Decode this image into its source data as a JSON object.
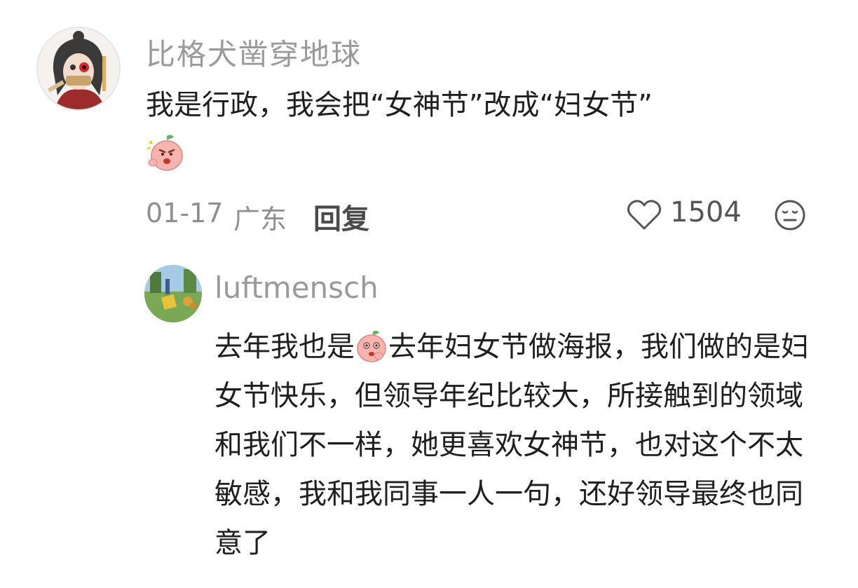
{
  "main_comment": {
    "username": "比格犬凿穿地球",
    "text": "我是行政，我会把“女神节”改成“妇女节”",
    "emoji_icon": "angry-peach-emoji",
    "date": "01-17",
    "location": "广东",
    "reply_label": "回复",
    "likes": "1504",
    "like_icon": "heart-outline-icon",
    "dislike_icon": "unhappy-face-icon"
  },
  "reply_comment": {
    "username": "luftmensch",
    "text_before_emoji": "去年我也是",
    "emoji_icon": "thinking-peach-emoji",
    "text_after_emoji": "去年妇女节做海报，我们做的是妇女节快乐，但领导年纪比较大，所接触到的领域和我们不一样，她更喜欢女神节，也对这个不太敏感，我和我同事一人一句，还好领导最终也同意了"
  },
  "colors": {
    "username": "#9a9a9a",
    "body_text": "#1f1f1f",
    "meta_text": "#8f8f8f",
    "peach": "#f7b3ad"
  }
}
